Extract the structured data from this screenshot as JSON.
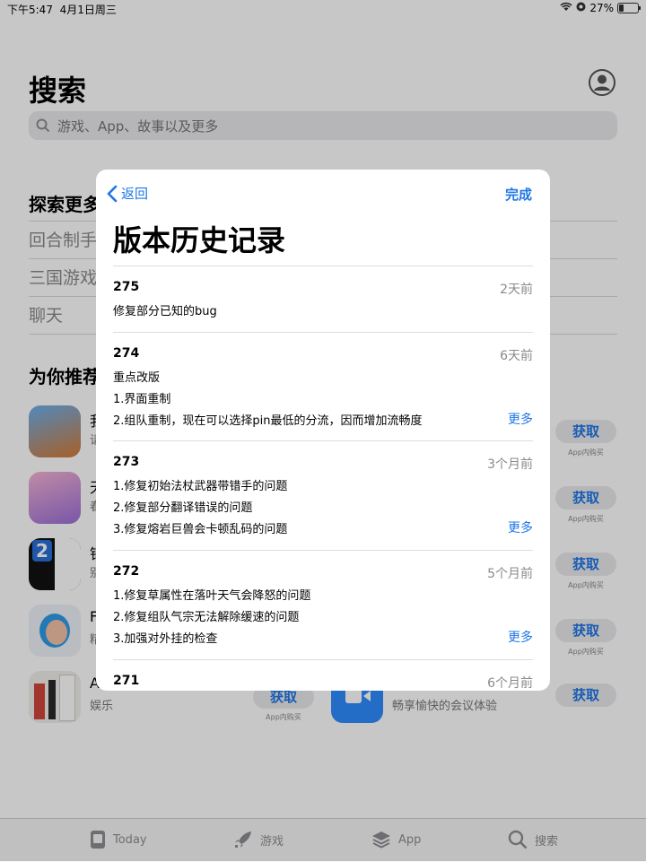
{
  "status_bar": {
    "time": "下午5:47",
    "date": "4月1日周三",
    "battery": "27%",
    "battery_level": 0.27
  },
  "search_page": {
    "title": "搜索",
    "search_placeholder": "游戏、App、故事以及更多",
    "explore_heading": "探索更多",
    "explore_items": [
      "回合制手",
      "三国游戏",
      "聊天"
    ],
    "recommend_heading": "为你推荐",
    "apps": [
      {
        "name": "我",
        "sub": "请",
        "get": "获取",
        "iap": "App内购买"
      },
      {
        "name": "天",
        "sub": "春",
        "get": "获取",
        "iap": "App内购买"
      },
      {
        "name": "钢",
        "sub": "别",
        "get": "获取",
        "iap": "App内购买"
      },
      {
        "name": "F",
        "sub": "精",
        "get": "获取",
        "iap": "App内购买"
      },
      {
        "name": "A",
        "sub": "娱乐",
        "get": "获取",
        "iap": "App内购买"
      }
    ],
    "right_col": {
      "sub": "畅享愉快的会议体验",
      "get": "获取"
    }
  },
  "tabbar": [
    {
      "label": "Today",
      "icon": "today-icon"
    },
    {
      "label": "游戏",
      "icon": "rocket-icon"
    },
    {
      "label": "App",
      "icon": "layers-icon"
    },
    {
      "label": "搜索",
      "icon": "search-icon"
    }
  ],
  "modal": {
    "back_label": "返回",
    "done_label": "完成",
    "title": "版本历史记录",
    "more_label": "更多",
    "versions": [
      {
        "version": "275",
        "date": "2天前",
        "notes": [
          "修复部分已知的bug"
        ]
      },
      {
        "version": "274",
        "date": "6天前",
        "notes": [
          "重点改版",
          "1.界面重制",
          "2.组队重制，现在可以选择pin最低的分流，因而增加流畅度"
        ]
      },
      {
        "version": "273",
        "date": "3个月前",
        "notes": [
          "1.修复初始法杖武器带错手的问题",
          "2.修复部分翻译错误的问题",
          "3.修复熔岩巨兽会卡顿乱码的问题"
        ]
      },
      {
        "version": "272",
        "date": "5个月前",
        "notes": [
          "1.修复草属性在落叶天气会降怒的问题",
          "2.修复组队气宗无法解除缓速的问题",
          "3.加强对外挂的检查"
        ]
      },
      {
        "version": "271",
        "date": "6个月前",
        "notes": []
      }
    ]
  }
}
